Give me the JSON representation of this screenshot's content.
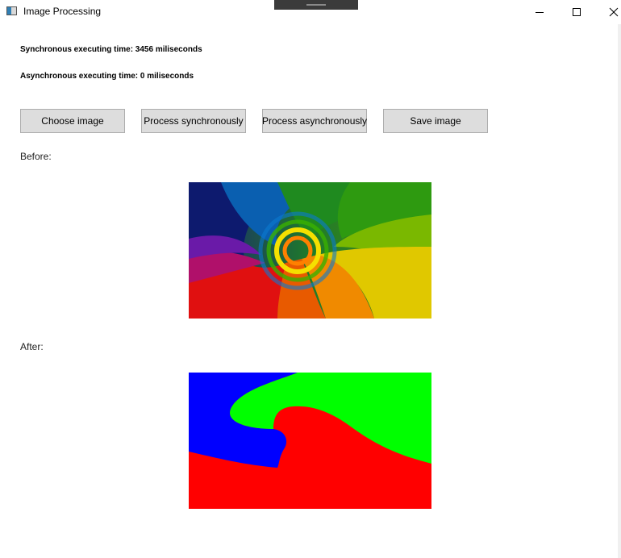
{
  "window": {
    "title": "Image Processing",
    "controls": [
      "minimize",
      "maximize",
      "close"
    ]
  },
  "stats": {
    "sync_text": "Synchronous executing time: 3456 miliseconds",
    "async_text": "Asynchronous executing time: 0 miliseconds"
  },
  "toolbar": {
    "choose_label": "Choose image",
    "sync_label": "Process synchronously",
    "async_label": "Process asynchronously",
    "save_label": "Save image"
  },
  "sections": {
    "before_label": "Before:",
    "after_label": "After:"
  },
  "images": {
    "before": "rainbow-swirl-photo",
    "after": "processed-rgb-segmented-image",
    "after_colors": [
      "#0000ff",
      "#00ff00",
      "#ff0000"
    ]
  }
}
